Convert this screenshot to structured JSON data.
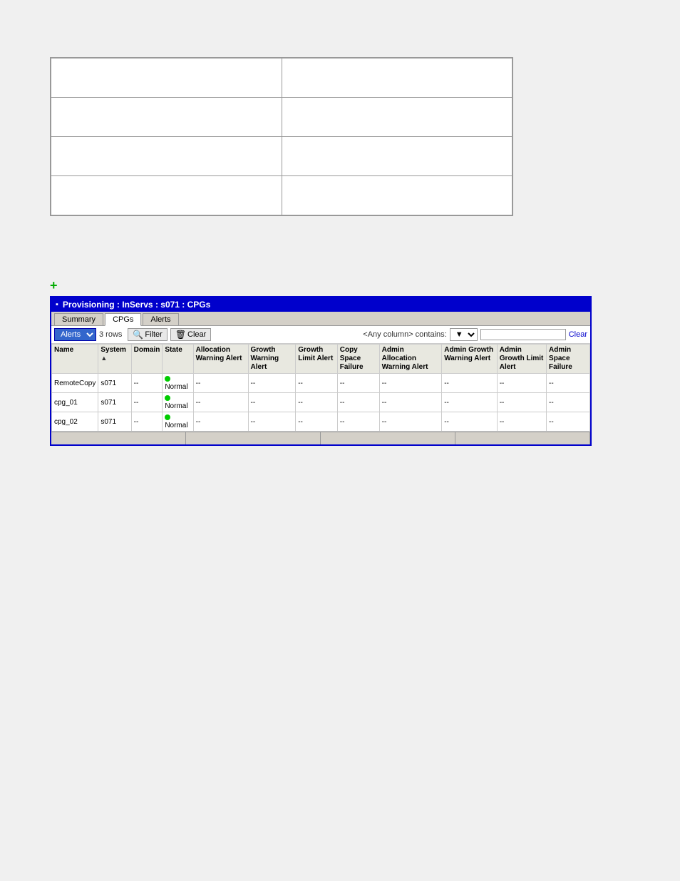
{
  "top_grid": {
    "cells": [
      [
        "",
        ""
      ],
      [
        "",
        ""
      ],
      [
        "",
        ""
      ],
      [
        "",
        ""
      ]
    ]
  },
  "green_plus": "+",
  "panel": {
    "title": "Provisioning : InServs : s071 : CPGs",
    "title_icon": "▪",
    "tabs": [
      {
        "label": "Summary",
        "active": false
      },
      {
        "label": "CPGs",
        "active": true
      },
      {
        "label": "Alerts",
        "active": false
      }
    ],
    "toolbar": {
      "dropdown_label": "Alerts",
      "count_text": "3 rows",
      "filter_btn": "Filter",
      "clear_btn": "Clear",
      "filter_label": "<Any column> contains:",
      "filter_placeholder": "",
      "clear_link": "Clear"
    },
    "table": {
      "columns": [
        "Name",
        "System",
        "Domain",
        "State",
        "Allocation Warning Alert",
        "Growth Warning Alert",
        "Growth Limit Alert",
        "Copy Space Failure",
        "Admin Allocation Warning Alert",
        "Admin Growth Warning Alert",
        "Admin Growth Limit Alert",
        "Admin Space Failure"
      ],
      "rows": [
        {
          "name": "RemoteCopy",
          "system": "s071",
          "domain": "--",
          "state": "Normal",
          "state_normal": true,
          "alloc_warn": "--",
          "growth_warn": "--",
          "growth_limit": "--",
          "copy_space": "--",
          "admin_alloc": "--",
          "admin_growth": "--",
          "admin_growth_limit": "--",
          "admin_space": "--"
        },
        {
          "name": "cpg_01",
          "system": "s071",
          "domain": "--",
          "state": "Normal",
          "state_normal": true,
          "alloc_warn": "--",
          "growth_warn": "--",
          "growth_limit": "--",
          "copy_space": "--",
          "admin_alloc": "--",
          "admin_growth": "--",
          "admin_growth_limit": "--",
          "admin_space": "--"
        },
        {
          "name": "cpg_02",
          "system": "s071",
          "domain": "--",
          "state": "Normal",
          "state_normal": true,
          "alloc_warn": "--",
          "growth_warn": "--",
          "growth_limit": "--",
          "copy_space": "--",
          "admin_alloc": "--",
          "admin_growth": "--",
          "admin_growth_limit": "--",
          "admin_space": "--"
        }
      ]
    },
    "status_cells": [
      "",
      "",
      "",
      "",
      "",
      "",
      "",
      "",
      "",
      "",
      "",
      ""
    ]
  }
}
